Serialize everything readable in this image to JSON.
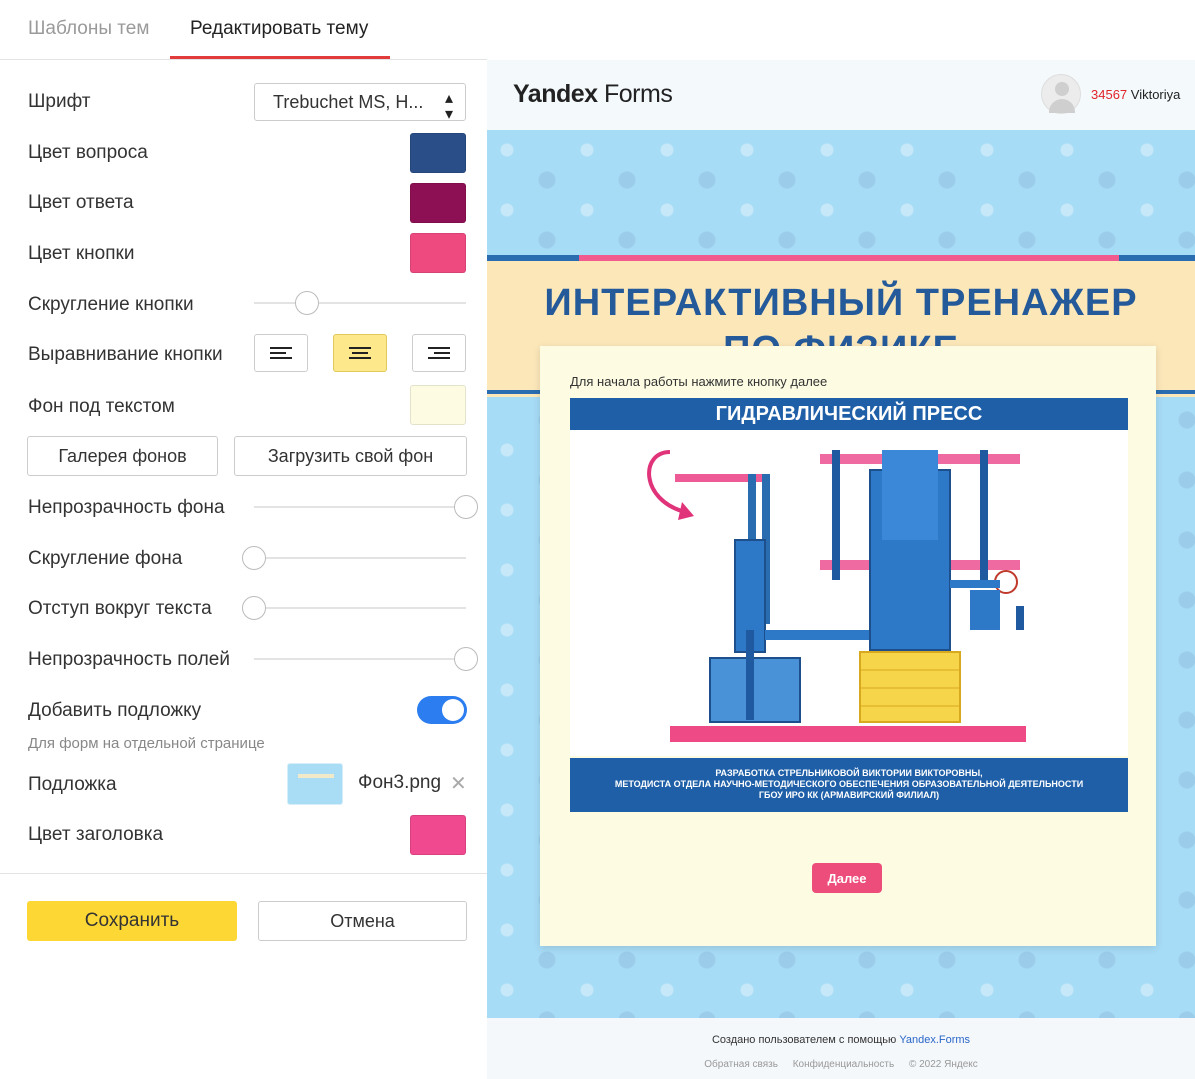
{
  "tabs": {
    "templates": "Шаблоны тем",
    "edit": "Редактировать тему"
  },
  "settings": {
    "font_label": "Шрифт",
    "font_value": "Trebuchet MS, H...",
    "question_color_label": "Цвет вопроса",
    "question_color": "#2a4f88",
    "answer_color_label": "Цвет ответа",
    "answer_color": "#8e1054",
    "button_color_label": "Цвет кнопки",
    "button_color": "#ee4a80",
    "button_radius_label": "Скругление кнопки",
    "button_radius_value": 0.25,
    "button_align_label": "Выравнивание кнопки",
    "button_align_options": [
      "left",
      "center",
      "right"
    ],
    "button_align_selected": "center",
    "text_bg_label": "Фон под текстом",
    "text_bg_color": "#fdfce3",
    "gallery_button": "Галерея фонов",
    "upload_button": "Загрузить свой фон",
    "bg_opacity_label": "Непрозрачность фона",
    "bg_opacity_value": 1.0,
    "bg_radius_label": "Скругление фона",
    "bg_radius_value": 0.0,
    "text_padding_label": "Отступ вокруг текста",
    "text_padding_value": 0.0,
    "fields_opacity_label": "Непрозрачность полей",
    "fields_opacity_value": 1.0,
    "backing_label": "Добавить подложку",
    "backing_enabled": true,
    "backing_hint": "Для форм на отдельной странице",
    "backing_file_label": "Подложка",
    "backing_file_name": "Фон3.png",
    "header_color_label": "Цвет заголовка",
    "header_color": "#f0498f"
  },
  "actions": {
    "save": "Сохранить",
    "cancel": "Отмена"
  },
  "preview": {
    "logo_bold": "Yandex",
    "logo_light": " Forms",
    "user_number": "34567",
    "user_name": " Viktoriya",
    "banner_title_line1": "ИНТЕРАКТИВНЫЙ ТРЕНАЖЕР",
    "banner_title_line2": "ПО ФИЗИКЕ",
    "intro_text": "Для начала работы нажмите кнопку далее",
    "image_title": "ГИДРАВЛИЧЕСКИЙ ПРЕСС",
    "image_footer_line1": "РАЗРАБОТКА СТРЕЛЬНИКОВОЙ ВИКТОРИИ ВИКТОРОВНЫ,",
    "image_footer_line2": "МЕТОДИСТА ОТДЕЛА НАУЧНО-МЕТОДИЧЕСКОГО ОБЕСПЕЧЕНИЯ ОБРАЗОВАТЕЛЬНОЙ ДЕЯТЕЛЬНОСТИ",
    "image_footer_line3": "ГБОУ ИРО КК (АРМАВИРСКИЙ ФИЛИАЛ)",
    "next_button": "Далее",
    "footer_created": "Создано пользователем с помощью ",
    "footer_link": "Yandex.Forms",
    "footer_feedback": "Обратная связь",
    "footer_privacy": "Конфиденциальность",
    "footer_copyright": "© 2022 Яндекс"
  }
}
